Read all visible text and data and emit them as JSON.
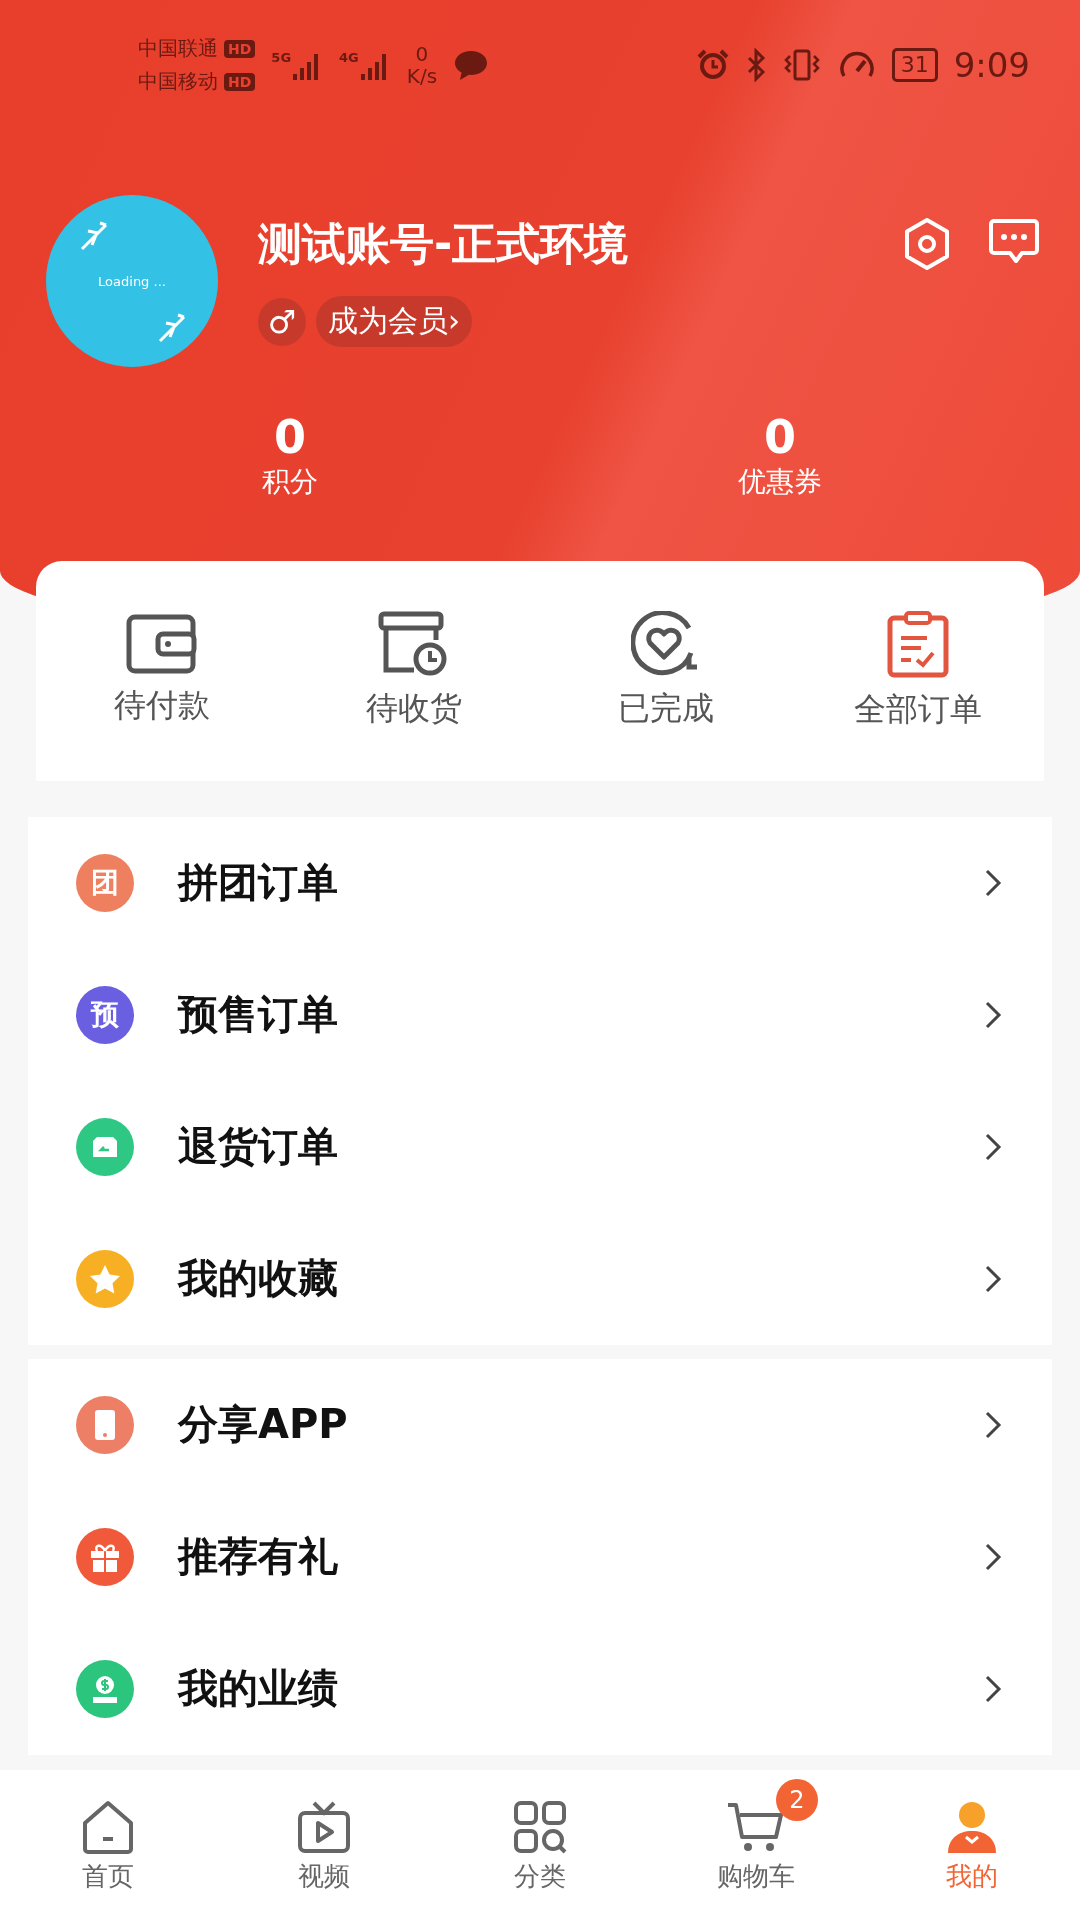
{
  "status_bar": {
    "carriers": [
      {
        "name": "中国联通",
        "badge": "HD"
      },
      {
        "name": "中国移动",
        "badge": "HD"
      }
    ],
    "net_types": [
      "5G",
      "4G"
    ],
    "speed_value": "0",
    "speed_unit": "K/s",
    "battery": "31",
    "time": "9:09"
  },
  "profile": {
    "avatar_text": "Loading ...",
    "name": "测试账号-正式环境",
    "gender_symbol": "♂",
    "member_link": "成为会员›"
  },
  "stats": [
    {
      "value": "0",
      "label": "积分"
    },
    {
      "value": "0",
      "label": "优惠券"
    }
  ],
  "orders": [
    {
      "kind": "wallet",
      "label": "待付款"
    },
    {
      "kind": "box-clock",
      "label": "待收货"
    },
    {
      "kind": "heart",
      "label": "已完成"
    },
    {
      "kind": "clipboard",
      "label": "全部订单"
    }
  ],
  "menu_groups": [
    [
      {
        "kind": "glyph",
        "glyph": "团",
        "color": "#ee7f5f",
        "label": "拼团订单"
      },
      {
        "kind": "glyph",
        "glyph": "预",
        "color": "#6a5fe0",
        "label": "预售订单"
      },
      {
        "kind": "box",
        "color": "#2ec884",
        "label": "退货订单"
      },
      {
        "kind": "star",
        "color": "#f7b023",
        "label": "我的收藏"
      }
    ],
    [
      {
        "kind": "phone",
        "color": "#ec7f66",
        "label": "分享APP"
      },
      {
        "kind": "gift",
        "color": "#f05a3a",
        "label": "推荐有礼"
      },
      {
        "kind": "money",
        "color": "#2cc57e",
        "label": "我的业绩"
      }
    ]
  ],
  "tab_bar": [
    {
      "kind": "home",
      "label": "首页",
      "selected": false
    },
    {
      "kind": "tv",
      "label": "视频",
      "selected": false
    },
    {
      "kind": "grid",
      "label": "分类",
      "selected": false
    },
    {
      "kind": "cart",
      "label": "购物车",
      "selected": false,
      "badge": "2"
    },
    {
      "kind": "person",
      "label": "我的",
      "selected": true
    }
  ]
}
